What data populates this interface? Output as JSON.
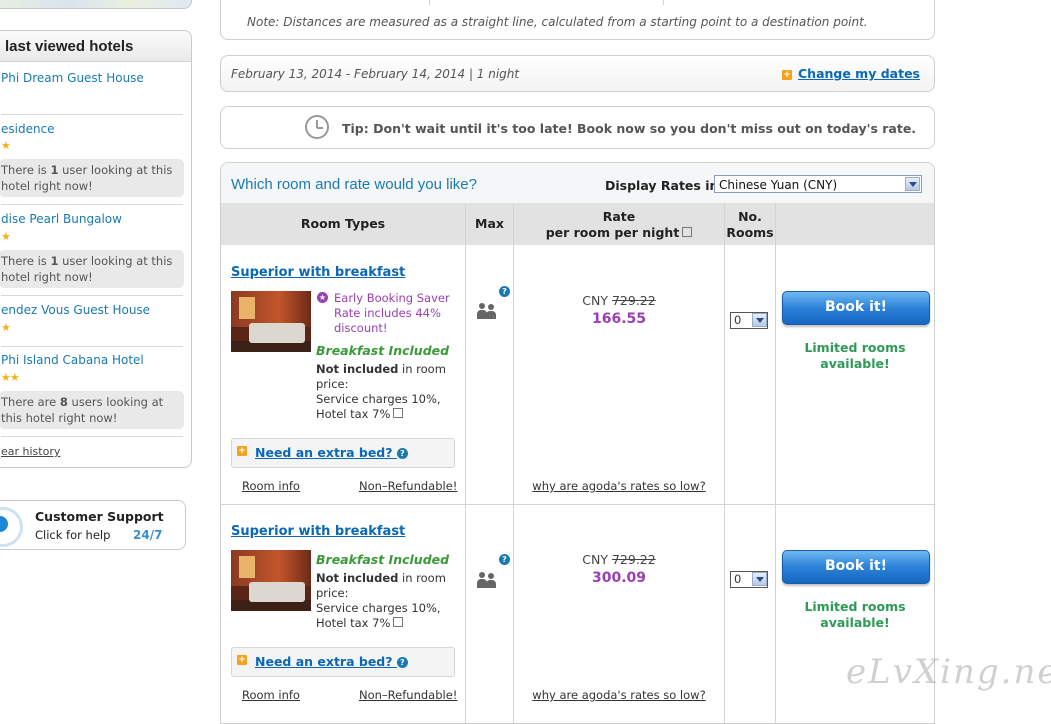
{
  "sidebar": {
    "recent_title": "last viewed hotels",
    "hotels": [
      {
        "name": "Phi Dream Guest House",
        "stars": "",
        "looking": ""
      },
      {
        "name": "esidence",
        "stars": "★",
        "looking_prefix": "There is ",
        "looking_count": "1",
        "looking_suffix": " user looking at this hotel right now!"
      },
      {
        "name": "dise Pearl Bungalow",
        "stars": "★",
        "looking_prefix": "There is ",
        "looking_count": "1",
        "looking_suffix": " user looking at this hotel right now!"
      },
      {
        "name": "endez Vous Guest House",
        "stars": "★",
        "looking": ""
      },
      {
        "name": "Phi Island Cabana Hotel",
        "stars": "★★",
        "looking_prefix": "There are ",
        "looking_count": "8",
        "looking_suffix": " users looking at this hotel right now!"
      }
    ],
    "clear_history": "ear history",
    "support_title": "Customer Support",
    "support_sub": "Click for help",
    "support_hours": "24/7"
  },
  "note": "Note: Distances are measured as a straight line, calculated from a starting point to a destination point.",
  "dates": {
    "text": "February 13, 2014 - February 14, 2014 | 1 night",
    "change_label": "Change my dates"
  },
  "tip": "Tip: Don't wait until it's too late! Book now so you don't miss out on today's rate.",
  "rooms": {
    "title": "Which room and rate would you like?",
    "display_rates_label": "Display Rates in:",
    "currency_selected": "Chinese Yuan (CNY)",
    "headers": {
      "room_types": "Room Types",
      "max": "Max",
      "rate_line1": "Rate",
      "rate_line2": "per room per night",
      "no_rooms_line1": "No.",
      "no_rooms_line2": "Rooms"
    },
    "list": [
      {
        "name": "Superior with breakfast",
        "promo_line1": "Early Booking Saver",
        "promo_line2": "Rate includes 44%",
        "promo_line3": "discount!",
        "breakfast": "Breakfast Included",
        "not_included_bold": "Not included",
        "not_included_rest": " in room price:",
        "charges": "Service charges 10%, Hotel tax 7%",
        "extra_bed": "Need an extra bed?",
        "room_info": "Room info",
        "refund": "Non–Refundable!",
        "currency": "CNY",
        "old_price": "729.22",
        "new_price": "166.55",
        "why_low": "why are agoda's rates so low?",
        "qty": "0",
        "book_label": "Book it!",
        "limited": "Limited rooms available!"
      },
      {
        "name": "Superior with breakfast",
        "breakfast": "Breakfast Included",
        "not_included_bold": "Not included",
        "not_included_rest": " in room price:",
        "charges": "Service charges 10%, Hotel tax 7%",
        "extra_bed": "Need an extra bed?",
        "room_info": "Room info",
        "refund": "Non–Refundable!",
        "currency": "CNY",
        "old_price": "729.22",
        "new_price": "300.09",
        "why_low": "why are agoda's rates so low?",
        "qty": "0",
        "book_label": "Book it!",
        "limited": "Limited rooms available!"
      }
    ]
  },
  "watermark": "eLvXing.net",
  "colors": {
    "link": "#0a68b4",
    "promo": "#9a3fb5",
    "green": "#2d9a55",
    "book_button": "#2b82d8"
  }
}
